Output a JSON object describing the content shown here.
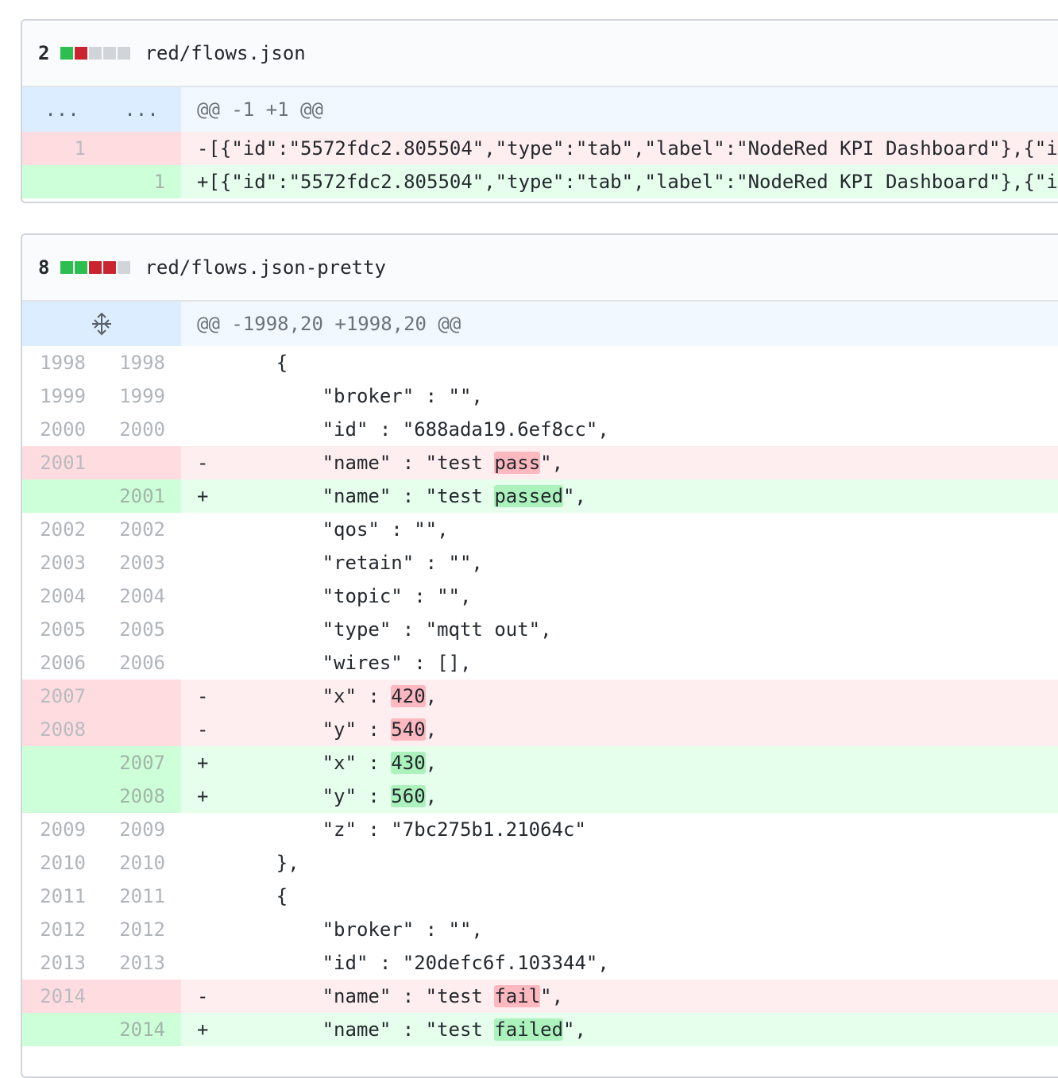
{
  "files": [
    {
      "changes": "2",
      "diffstat": [
        "add",
        "del",
        "neu",
        "neu",
        "neu"
      ],
      "name": "red/flows.json",
      "hunk": "@@ -1 +1 @@",
      "ellipsis": "...",
      "rows": [
        {
          "type": "del",
          "old": "1",
          "new": "",
          "marker": "-",
          "segs": [
            {
              "t": "[{\"id\":\"5572fdc2.805504\",\"type\":\"tab\",\"label\":\"NodeRed KPI Dashboard\"},{\"i"
            }
          ]
        },
        {
          "type": "add",
          "old": "",
          "new": "1",
          "marker": "+",
          "segs": [
            {
              "t": "[{\"id\":\"5572fdc2.805504\",\"type\":\"tab\",\"label\":\"NodeRed KPI Dashboard\"},{\"i"
            }
          ]
        }
      ]
    },
    {
      "changes": "8",
      "diffstat": [
        "add",
        "add",
        "del",
        "del",
        "neu"
      ],
      "name": "red/flows.json-pretty",
      "hunk": "@@ -1998,20 +1998,20 @@",
      "rows": [
        {
          "type": "ctx",
          "old": "1998",
          "new": "1998",
          "marker": "",
          "segs": [
            {
              "t": "    {"
            }
          ]
        },
        {
          "type": "ctx",
          "old": "1999",
          "new": "1999",
          "marker": "",
          "segs": [
            {
              "t": "        \"broker\" : \"\","
            }
          ]
        },
        {
          "type": "ctx",
          "old": "2000",
          "new": "2000",
          "marker": "",
          "segs": [
            {
              "t": "        \"id\" : \"688ada19.6ef8cc\","
            }
          ]
        },
        {
          "type": "del",
          "old": "2001",
          "new": "",
          "marker": "-",
          "segs": [
            {
              "t": "        \"name\" : \"test "
            },
            {
              "t": "pass",
              "h": 1
            },
            {
              "t": "\","
            }
          ]
        },
        {
          "type": "add",
          "old": "",
          "new": "2001",
          "marker": "+",
          "segs": [
            {
              "t": "        \"name\" : \"test "
            },
            {
              "t": "passed",
              "h": 1
            },
            {
              "t": "\","
            }
          ]
        },
        {
          "type": "ctx",
          "old": "2002",
          "new": "2002",
          "marker": "",
          "segs": [
            {
              "t": "        \"qos\" : \"\","
            }
          ]
        },
        {
          "type": "ctx",
          "old": "2003",
          "new": "2003",
          "marker": "",
          "segs": [
            {
              "t": "        \"retain\" : \"\","
            }
          ]
        },
        {
          "type": "ctx",
          "old": "2004",
          "new": "2004",
          "marker": "",
          "segs": [
            {
              "t": "        \"topic\" : \"\","
            }
          ]
        },
        {
          "type": "ctx",
          "old": "2005",
          "new": "2005",
          "marker": "",
          "segs": [
            {
              "t": "        \"type\" : \"mqtt out\","
            }
          ]
        },
        {
          "type": "ctx",
          "old": "2006",
          "new": "2006",
          "marker": "",
          "segs": [
            {
              "t": "        \"wires\" : [],"
            }
          ]
        },
        {
          "type": "del",
          "old": "2007",
          "new": "",
          "marker": "-",
          "segs": [
            {
              "t": "        \"x\" : "
            },
            {
              "t": "420",
              "h": 1
            },
            {
              "t": ","
            }
          ]
        },
        {
          "type": "del",
          "old": "2008",
          "new": "",
          "marker": "-",
          "segs": [
            {
              "t": "        \"y\" : "
            },
            {
              "t": "540",
              "h": 1
            },
            {
              "t": ","
            }
          ]
        },
        {
          "type": "add",
          "old": "",
          "new": "2007",
          "marker": "+",
          "segs": [
            {
              "t": "        \"x\" : "
            },
            {
              "t": "430",
              "h": 1
            },
            {
              "t": ","
            }
          ]
        },
        {
          "type": "add",
          "old": "",
          "new": "2008",
          "marker": "+",
          "segs": [
            {
              "t": "        \"y\" : "
            },
            {
              "t": "560",
              "h": 1
            },
            {
              "t": ","
            }
          ]
        },
        {
          "type": "ctx",
          "old": "2009",
          "new": "2009",
          "marker": "",
          "segs": [
            {
              "t": "        \"z\" : \"7bc275b1.21064c\""
            }
          ]
        },
        {
          "type": "ctx",
          "old": "2010",
          "new": "2010",
          "marker": "",
          "segs": [
            {
              "t": "    },"
            }
          ]
        },
        {
          "type": "ctx",
          "old": "2011",
          "new": "2011",
          "marker": "",
          "segs": [
            {
              "t": "    {"
            }
          ]
        },
        {
          "type": "ctx",
          "old": "2012",
          "new": "2012",
          "marker": "",
          "segs": [
            {
              "t": "        \"broker\" : \"\","
            }
          ]
        },
        {
          "type": "ctx",
          "old": "2013",
          "new": "2013",
          "marker": "",
          "segs": [
            {
              "t": "        \"id\" : \"20defc6f.103344\","
            }
          ]
        },
        {
          "type": "del",
          "old": "2014",
          "new": "",
          "marker": "-",
          "segs": [
            {
              "t": "        \"name\" : \"test "
            },
            {
              "t": "fail",
              "h": 1
            },
            {
              "t": "\","
            }
          ]
        },
        {
          "type": "add",
          "old": "",
          "new": "2014",
          "marker": "+",
          "segs": [
            {
              "t": "        \"name\" : \"test "
            },
            {
              "t": "failed",
              "h": 1
            },
            {
              "t": "\","
            }
          ]
        }
      ]
    }
  ]
}
